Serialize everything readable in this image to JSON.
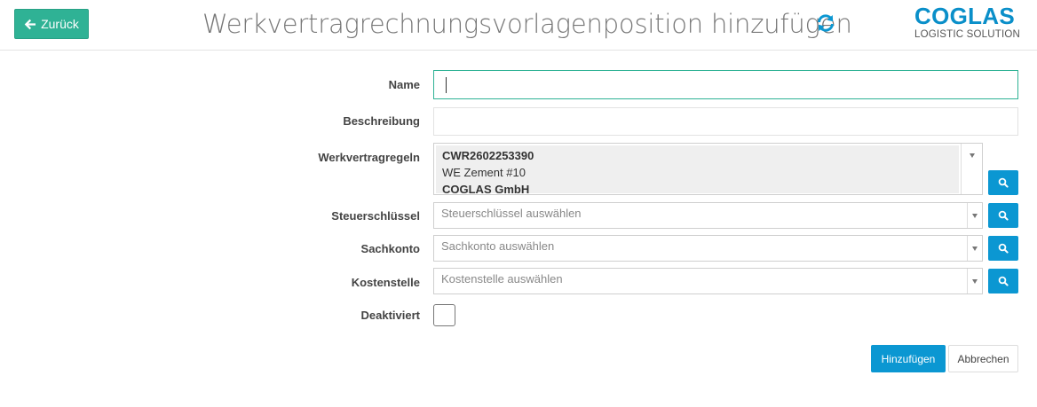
{
  "header": {
    "back_label": "Zurück",
    "title": "Werkvertragrechnungsvorlagenposition hinzufügen",
    "logo_main": "COGLAS",
    "logo_sub": "LOGISTIC SOLUTION"
  },
  "colors": {
    "back_button": "#2fb295",
    "primary": "#0b97d2",
    "logo": "#0a8fc9"
  },
  "icons": {
    "back": "arrow-left-icon",
    "refresh": "refresh-icon",
    "search": "search-icon",
    "dropdown": "caret-down-icon"
  },
  "form": {
    "name": {
      "label": "Name",
      "value": ""
    },
    "beschreibung": {
      "label": "Beschreibung",
      "value": ""
    },
    "werkvertragregeln": {
      "label": "Werkvertragregeln",
      "selected": {
        "line1": "CWR2602253390",
        "line2": "WE Zement #10",
        "line3": "COGLAS GmbH"
      }
    },
    "steuerschluessel": {
      "label": "Steuerschlüssel",
      "placeholder": "Steuerschlüssel auswählen"
    },
    "sachkonto": {
      "label": "Sachkonto",
      "placeholder": "Sachkonto auswählen"
    },
    "kostenstelle": {
      "label": "Kostenstelle",
      "placeholder": "Kostenstelle auswählen"
    },
    "deaktiviert": {
      "label": "Deaktiviert",
      "checked": false
    }
  },
  "actions": {
    "add_label": "Hinzufügen",
    "cancel_label": "Abbrechen"
  }
}
